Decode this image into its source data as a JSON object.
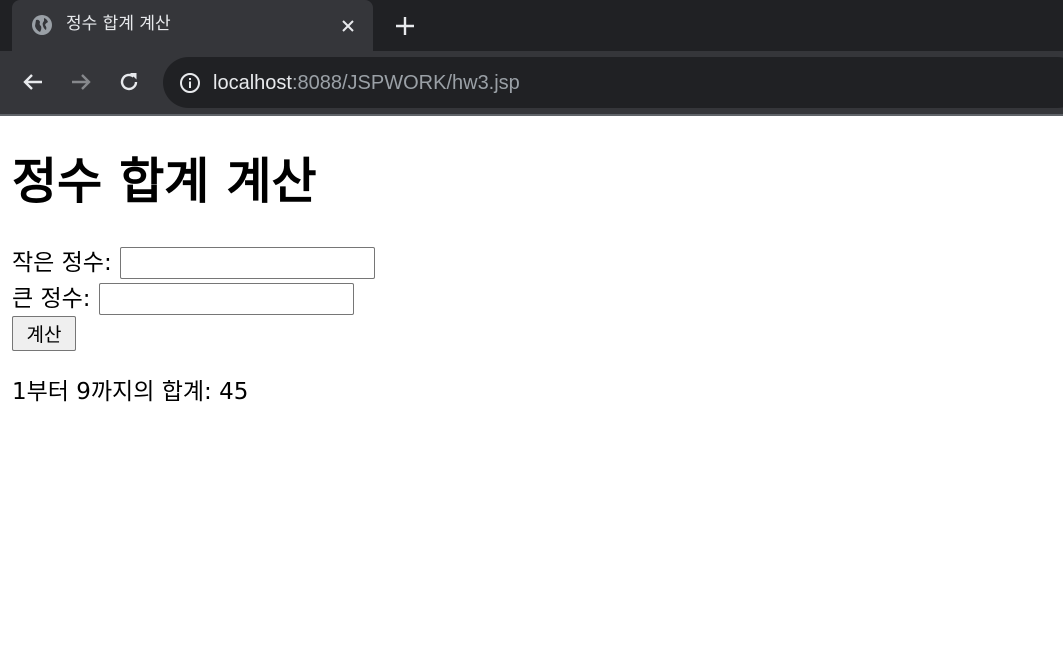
{
  "browser": {
    "tab": {
      "title": "정수 합계 계산",
      "favicon_icon": "globe-icon",
      "close_icon": "close-icon"
    },
    "new_tab_icon": "plus-icon",
    "nav": {
      "back_icon": "arrow-left-icon",
      "forward_icon": "arrow-right-icon",
      "reload_icon": "reload-icon"
    },
    "address": {
      "info_icon": "info-icon",
      "host": "localhost",
      "rest": ":8088/JSPWORK/hw3.jsp"
    },
    "colors": {
      "tabstrip": "#202124",
      "toolbar": "#35363a",
      "omnibox": "#202124"
    }
  },
  "page": {
    "title": "정수 합계 계산",
    "form": {
      "small_label": "작은 정수:",
      "small_value": "",
      "large_label": "큰 정수:",
      "large_value": "",
      "submit_label": "계산"
    },
    "result": "1부터 9까지의 합계: 45"
  }
}
